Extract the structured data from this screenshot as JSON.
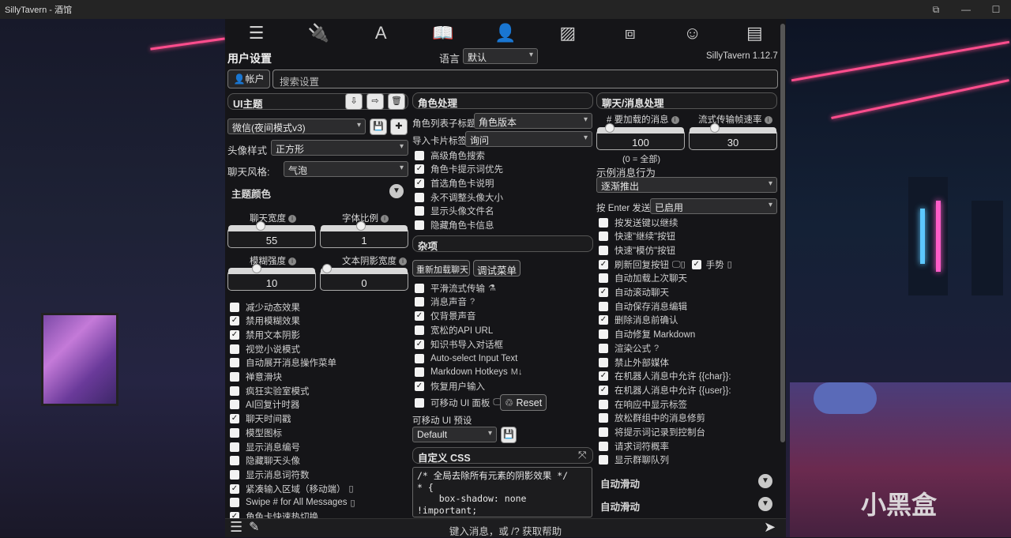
{
  "window": {
    "title": "SillyTavern - 酒馆",
    "controls": [
      "⧉",
      "—",
      "☐"
    ]
  },
  "nav": {
    "icons": [
      "sliders-icon",
      "plug-icon",
      "font-icon",
      "book-icon",
      "user-gear-icon",
      "image-icon",
      "cubes-icon",
      "smile-icon",
      "id-card-icon"
    ]
  },
  "header": {
    "title": "用户设置",
    "lang_label": "语言",
    "lang_value": "默认",
    "version": "SillyTavern 1.12.7",
    "account_btn": "帐户",
    "search_placeholder": "搜索设置"
  },
  "col1": {
    "theme_header": "UI主题",
    "theme_value": "微信(夜间模式v3)",
    "avatar_style_label": "头像样式",
    "avatar_style_value": "正方形",
    "chat_style_label": "聊天风格:",
    "chat_style_value": "气泡",
    "theme_colors": "主题颜色",
    "sliders": [
      {
        "label": "聊天宽度",
        "value": "55",
        "fraction": 0.35
      },
      {
        "label": "字体比例",
        "value": "1",
        "fraction": 0.45
      },
      {
        "label": "模糊强度",
        "value": "10",
        "fraction": 0.3
      },
      {
        "label": "文本阴影宽度",
        "value": "0",
        "fraction": 0.02
      }
    ],
    "checks": [
      {
        "label": "减少动态效果",
        "checked": false
      },
      {
        "label": "禁用模糊效果",
        "checked": true
      },
      {
        "label": "禁用文本阴影",
        "checked": true
      },
      {
        "label": "视觉小说模式",
        "checked": false
      },
      {
        "label": "自动展开消息操作菜单",
        "checked": false
      },
      {
        "label": "禅意滑块",
        "checked": false
      },
      {
        "label": "疯狂实验室模式",
        "checked": false
      },
      {
        "label": "AI回复计时器",
        "checked": false
      },
      {
        "label": "聊天时间戳",
        "checked": true
      },
      {
        "label": "模型图标",
        "checked": false
      },
      {
        "label": "显示消息编号",
        "checked": false
      },
      {
        "label": "隐藏聊天头像",
        "checked": false
      },
      {
        "label": "显示消息词符数",
        "checked": false
      },
      {
        "label": "紧凑输入区域（移动端）",
        "checked": true,
        "extra": "▯"
      },
      {
        "label": "Swipe # for All Messages",
        "checked": false,
        "extra": "▯"
      },
      {
        "label": "角色卡快速热切换",
        "checked": true
      }
    ]
  },
  "col2": {
    "char_header": "角色处理",
    "list_label": "角色列表子标题",
    "list_value": "角色版本",
    "import_label": "导入卡片标签",
    "import_value": "询问",
    "char_checks": [
      {
        "label": "高级角色搜索",
        "checked": false
      },
      {
        "label": "角色卡提示词优先",
        "checked": true
      },
      {
        "label": "首选角色卡说明",
        "checked": true
      },
      {
        "label": "永不调整头像大小",
        "checked": false
      },
      {
        "label": "显示头像文件名",
        "checked": false
      },
      {
        "label": "隐藏角色卡信息",
        "checked": false
      }
    ],
    "misc_header": "杂项",
    "reload_btn": "重新加载聊天",
    "debug_btn": "调试菜单",
    "misc_checks": [
      {
        "label": "平滑流式传输",
        "checked": false,
        "extra": "⚗"
      },
      {
        "label": "消息声音",
        "checked": false,
        "extra": "?"
      },
      {
        "label": "仅背景声音",
        "checked": true
      },
      {
        "label": "宽松的API URL",
        "checked": false
      },
      {
        "label": "知识书导入对话框",
        "checked": true
      },
      {
        "label": "Auto-select Input Text",
        "checked": false
      },
      {
        "label": "Markdown Hotkeys",
        "checked": false,
        "extra": "M↓"
      },
      {
        "label": "恢复用户输入",
        "checked": true
      }
    ],
    "movable_label": "可移动 UI 面板",
    "reset_btn": "Reset",
    "preset_label": "可移动 UI 预设",
    "preset_value": "Default",
    "css_header": "自定义 CSS",
    "css_text": "/* 全局去除所有元素的阴影效果 */\n* {\n    box-shadow: none\n!important;"
  },
  "col3": {
    "chat_header": "聊天/消息处理",
    "load_label": "# 要加载的消息",
    "load_value": "100",
    "load_note": "(0 = 全部)",
    "stream_label": "流式传输帧速率",
    "stream_value": "30",
    "example_label": "示例消息行为",
    "example_value": "逐渐推出",
    "enter_label": "按 Enter 发送",
    "enter_value": "已启用",
    "checks": [
      {
        "label": "按发送键以继续",
        "checked": false
      },
      {
        "label": "快速\"继续\"按钮",
        "checked": false
      },
      {
        "label": "快速\"模仿\"按钮",
        "checked": false
      },
      {
        "label": "刷新回复按钮",
        "checked": true,
        "extra": "🖵▯",
        "extra2": "手势"
      },
      {
        "label": "自动加载上次聊天",
        "checked": false
      },
      {
        "label": "自动滚动聊天",
        "checked": true
      },
      {
        "label": "自动保存消息编辑",
        "checked": false
      },
      {
        "label": "删除消息前确认",
        "checked": true
      },
      {
        "label": "自动修复 Markdown",
        "checked": false
      },
      {
        "label": "渲染公式",
        "checked": false,
        "extra": "?"
      },
      {
        "label": "禁止外部媒体",
        "checked": false
      },
      {
        "label": "在机器人消息中允许 {{char}}:",
        "checked": true
      },
      {
        "label": "在机器人消息中允许 {{user}}:",
        "checked": true
      },
      {
        "label": "在响应中显示标签",
        "checked": false
      },
      {
        "label": "放松群组中的消息修剪",
        "checked": false
      },
      {
        "label": "将提示词记录到控制台",
        "checked": false
      },
      {
        "label": "请求词符概率",
        "checked": false
      },
      {
        "label": "显示群聊队列",
        "checked": false
      }
    ],
    "auto_scroll_1": "自动滑动",
    "auto_scroll_2": "自动滑动"
  },
  "bottom": {
    "placeholder": "键入消息，或 /? 获取帮助"
  },
  "watermark": "小黑盒"
}
